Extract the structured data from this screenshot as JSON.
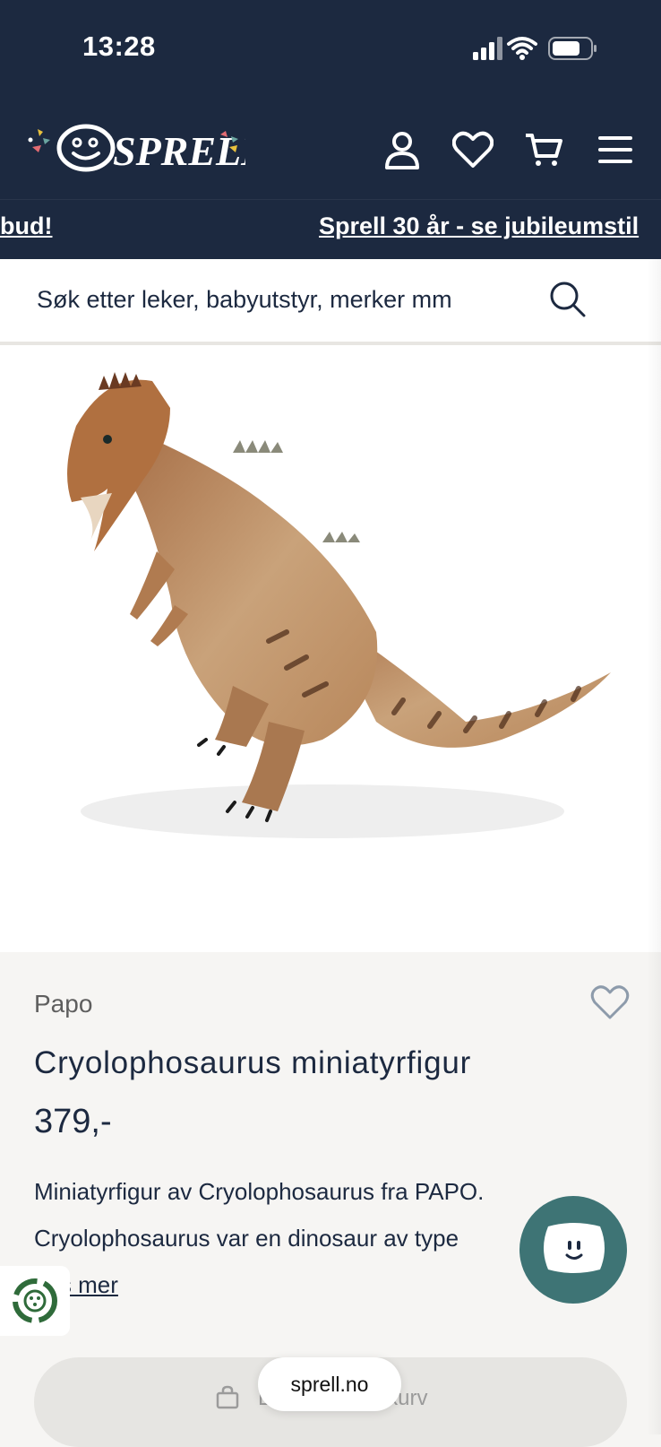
{
  "status_bar": {
    "time": "13:28"
  },
  "header": {
    "logo_text": "SPRELL",
    "icons": [
      "account-icon",
      "heart-icon",
      "cart-icon",
      "menu-icon"
    ]
  },
  "ticker": {
    "left_text": "bud!",
    "right_text": "Sprell 30 år - se jubileumstil"
  },
  "search": {
    "placeholder": "Søk etter leker, babyutstyr, merker mm"
  },
  "product": {
    "brand": "Papo",
    "title": "Cryolophosaurus miniatyrfigur",
    "price": "379,-",
    "description_line1": "Miniatyrfigur av Cryolophosaurus fra PAPO.",
    "description_line2": "Cryolophosaurus var en dinosaur av type",
    "read_more": "Les mer"
  },
  "cart_button": {
    "label": "Legg i handlekurv"
  },
  "browser": {
    "url": "sprell.no"
  },
  "colors": {
    "header_bg": "#1c2940",
    "chat_bg": "#3e7475",
    "accent_pink": "#e26b72",
    "accent_yellow": "#e8c13d",
    "accent_teal": "#6aa5a0"
  }
}
